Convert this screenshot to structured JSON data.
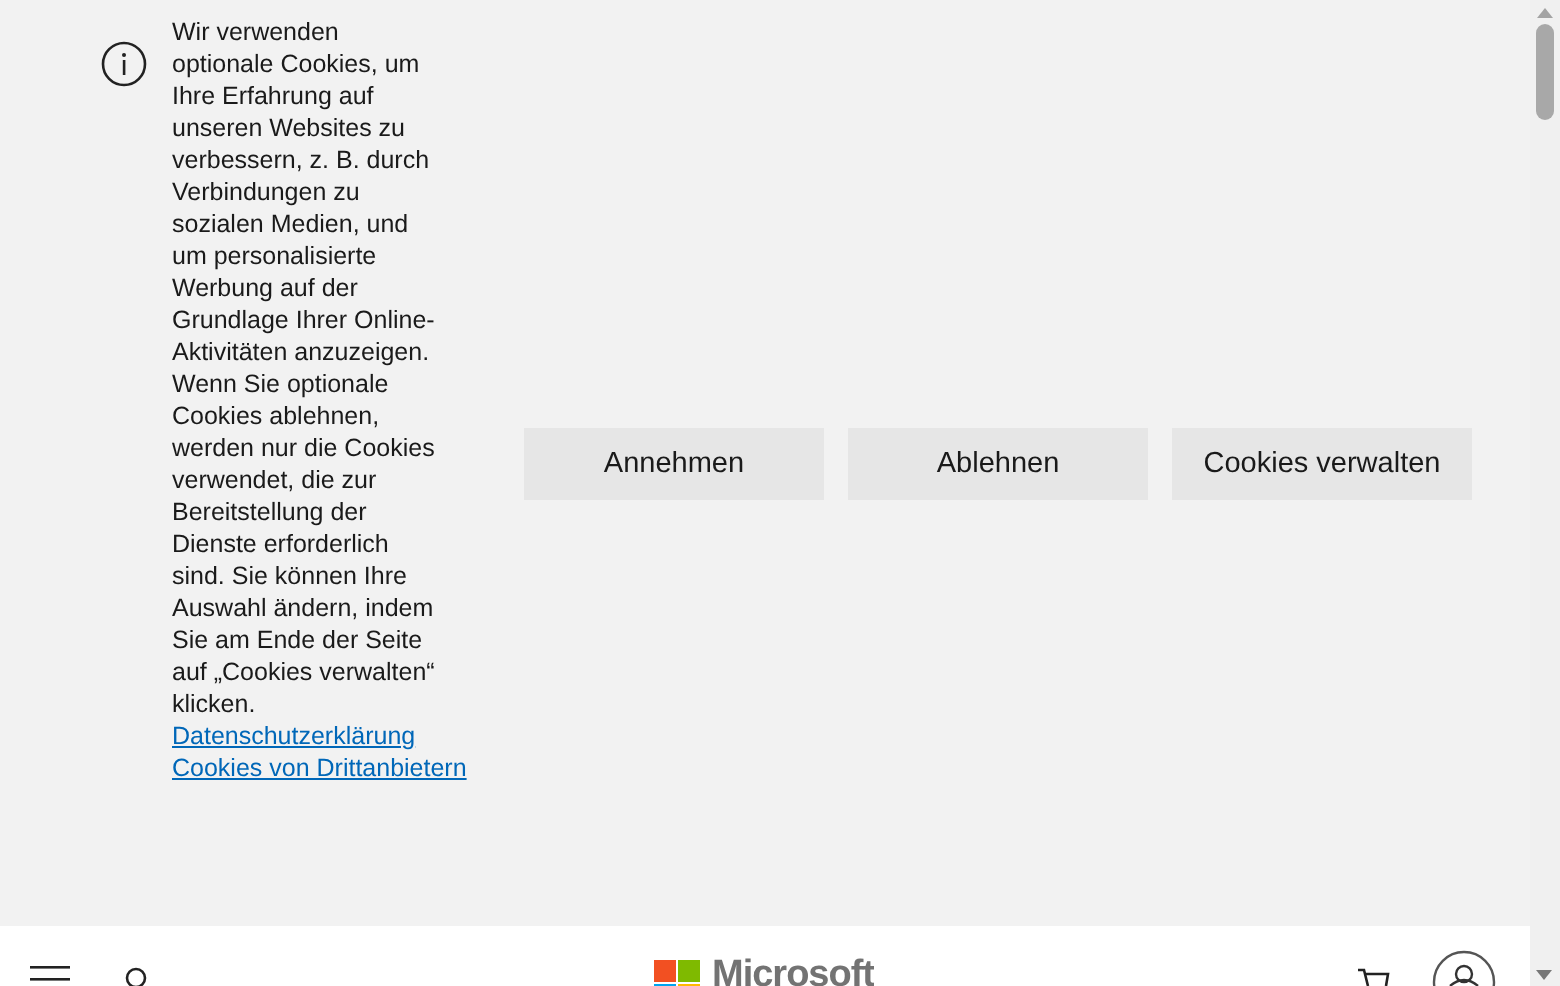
{
  "cookie_banner": {
    "message": "Wir verwenden optionale Cookies, um Ihre Erfahrung auf unseren Websites zu verbessern, z. B. durch Verbindungen zu sozialen Medien, und um personalisierte Werbung auf der Grundlage Ihrer Online-Aktivitäten anzuzeigen. Wenn Sie optionale Cookies ablehnen, werden nur die Cookies verwendet, die zur Bereitstellung der Dienste erforderlich sind. Sie können Ihre Auswahl ändern, indem Sie am Ende der Seite auf „Cookies verwalten“ klicken.",
    "links": [
      "Datenschutzerklärung",
      "Cookies von Drittanbietern"
    ],
    "buttons": [
      "Annehmen",
      "Ablehnen",
      "Cookies verwalten"
    ]
  },
  "header": {
    "logo_text": "Microsoft"
  }
}
